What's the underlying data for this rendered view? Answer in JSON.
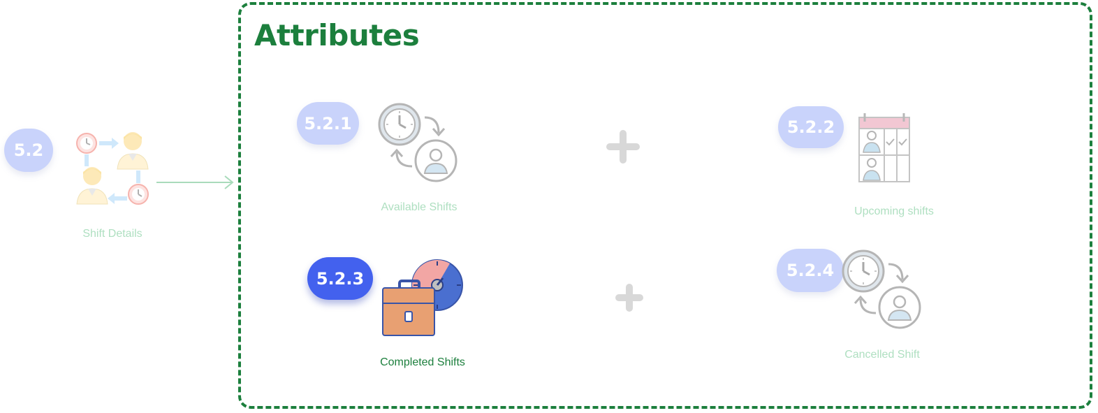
{
  "title": "Attributes",
  "parent": {
    "badge": "5.2",
    "label": "Shift Details"
  },
  "attributes": [
    {
      "badge": "5.2.1",
      "label": "Available Shifts",
      "icon": "clock-user-cycle-icon",
      "state": "faded"
    },
    {
      "badge": "5.2.2",
      "label": "Upcoming shifts",
      "icon": "calendar-schedule-icon",
      "state": "faded"
    },
    {
      "badge": "5.2.3",
      "label": "Completed Shifts",
      "icon": "briefcase-clock-icon",
      "state": "active"
    },
    {
      "badge": "5.2.4",
      "label": "Cancelled Shift",
      "icon": "clock-user-cycle-icon",
      "state": "faded"
    }
  ],
  "colors": {
    "accent_green": "#1c7f3d",
    "badge_active": "#4361ee",
    "badge_faded": "#c9d3fb",
    "label_faded": "#aedfc0"
  }
}
